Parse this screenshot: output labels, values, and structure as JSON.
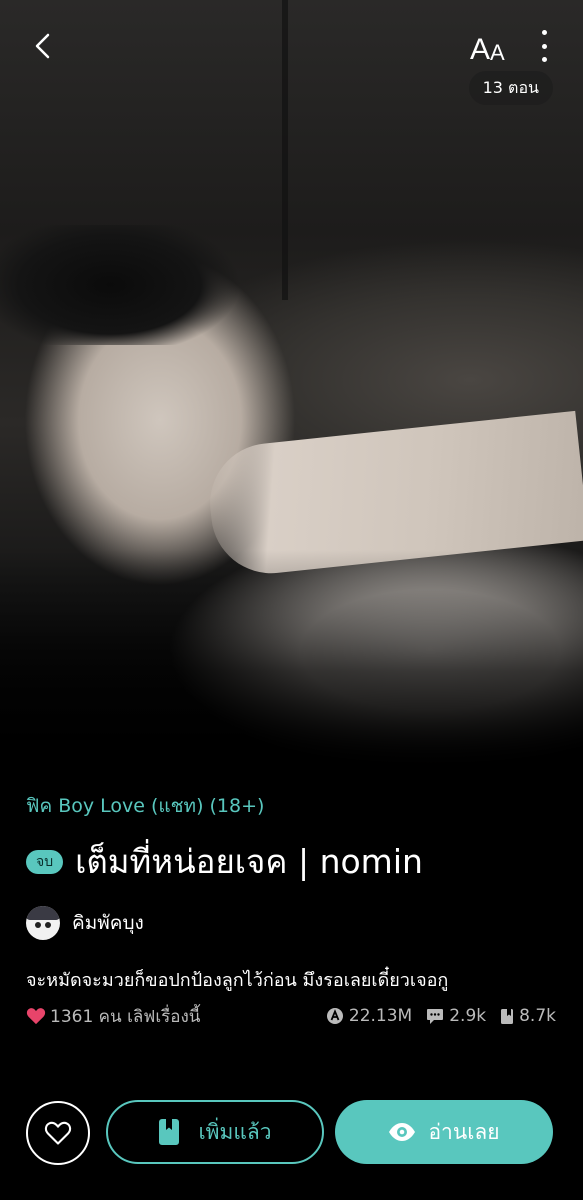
{
  "header": {
    "font_size_label_big": "A",
    "font_size_label_small": "A",
    "episodes": "13 ตอน"
  },
  "story": {
    "category": "ฟิค Boy Love (แชท) (18+)",
    "status_badge": "จบ",
    "title": "เต็มที่หน่อยเจค | nomin",
    "author": "คิมพัคบุง",
    "description": "จะหมัดจะมวยก็ขอปกป้องลูกไว้ก่อน มึงรอเลยเดี๋ยวเจอกู",
    "likes": "1361 คน เลิฟเรื่องนี้",
    "views": "22.13M",
    "comments": "2.9k",
    "saves": "8.7k"
  },
  "actions": {
    "added_label": "เพิ่มแล้ว",
    "read_label": "อ่านเลย"
  },
  "colors": {
    "accent": "#59c7be",
    "like_heart": "#e8446a",
    "background": "#000000"
  },
  "icons": [
    "back-arrow-icon",
    "font-size-icon",
    "more-vertical-icon",
    "heart-icon",
    "views-icon",
    "comment-icon",
    "bookmark-icon",
    "heart-outline-icon",
    "book-icon",
    "eye-icon"
  ]
}
